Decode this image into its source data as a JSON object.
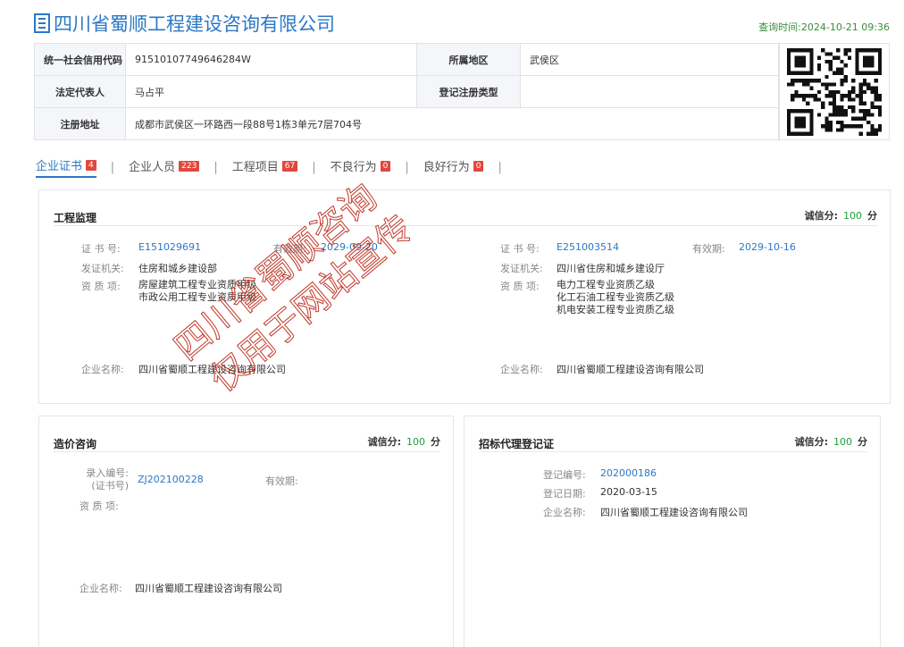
{
  "header": {
    "title": "四川省蜀顺工程建设咨询有限公司",
    "query_time": "查询时间:2024-10-21 09:36"
  },
  "info": {
    "credit_code_label": "统一社会信用代码",
    "credit_code": "91510107749646284W",
    "region_label": "所属地区",
    "region": "武侯区",
    "legal_rep_label": "法定代表人",
    "legal_rep": "马占平",
    "reg_type_label": "登记注册类型",
    "reg_type": "",
    "address_label": "注册地址",
    "address": "成都市武侯区一环路西一段88号1栋3单元7层704号"
  },
  "tabs": [
    {
      "label": "企业证书",
      "count": "4"
    },
    {
      "label": "企业人员",
      "count": "223"
    },
    {
      "label": "工程项目",
      "count": "67"
    },
    {
      "label": "不良行为",
      "count": "0"
    },
    {
      "label": "良好行为",
      "count": "0"
    }
  ],
  "tab_separator": "|",
  "watermark": {
    "line1": "四川省蜀顺咨询",
    "line2": "仅用于网站宣传"
  },
  "supervision": {
    "title": "工程监理",
    "score_label": "诚信分:",
    "score": "100",
    "score_unit": "分",
    "cert_no_label": "证 书 号:",
    "valid_label": "有效期:",
    "issuer_label": "发证机关:",
    "qual_label": "资 质 项:",
    "company_label": "企业名称:",
    "left": {
      "cert_no": "E151029691",
      "valid": "2029-09-20",
      "issuer": "住房和城乡建设部",
      "qual_1": "房屋建筑工程专业资质甲级",
      "qual_2": "市政公用工程专业资质甲级",
      "company": "四川省蜀顺工程建设咨询有限公司"
    },
    "right": {
      "cert_no": "E251003514",
      "valid": "2029-10-16",
      "issuer": "四川省住房和城乡建设厅",
      "qual_1": "电力工程专业资质乙级",
      "qual_2": "化工石油工程专业资质乙级",
      "qual_3": "机电安装工程专业资质乙级",
      "company": "四川省蜀顺工程建设咨询有限公司"
    }
  },
  "cost": {
    "title": "造价咨询",
    "score_label": "诚信分:",
    "score": "100",
    "score_unit": "分",
    "entry_label_1": "录入编号:",
    "entry_label_2": "(证书号)",
    "entry_no": "ZJ202100228",
    "valid_label": "有效期:",
    "qual_label": "资 质 项:",
    "company_label": "企业名称:",
    "company": "四川省蜀顺工程建设咨询有限公司"
  },
  "tender": {
    "title": "招标代理登记证",
    "score_label": "诚信分:",
    "score": "100",
    "score_unit": "分",
    "reg_no_label": "登记编号:",
    "reg_no": "202000186",
    "reg_date_label": "登记日期:",
    "reg_date": "2020-03-15",
    "company_label": "企业名称:",
    "company": "四川省蜀顺工程建设咨询有限公司"
  },
  "colors": {
    "brand_blue": "#2b78c5",
    "badge_red": "#e2473f",
    "score_green": "#1f9d3a",
    "time_green": "#3a8d3a",
    "watermark_red": "#c0392b"
  },
  "icons": {
    "title_icon": "building-icon",
    "qr": "qr-code"
  }
}
